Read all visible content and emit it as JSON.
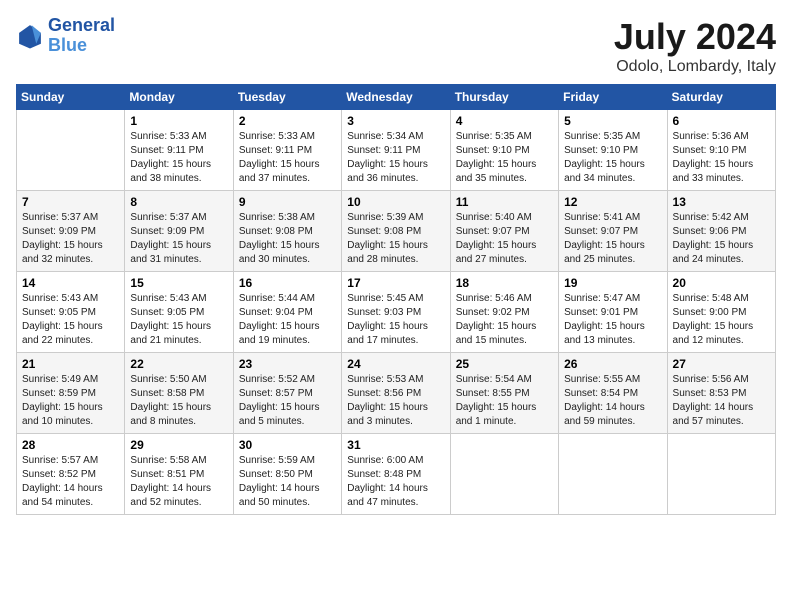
{
  "header": {
    "logo_general": "General",
    "logo_blue": "Blue",
    "title": "July 2024",
    "location": "Odolo, Lombardy, Italy"
  },
  "calendar": {
    "days_of_week": [
      "Sunday",
      "Monday",
      "Tuesday",
      "Wednesday",
      "Thursday",
      "Friday",
      "Saturday"
    ],
    "weeks": [
      [
        {
          "day": "",
          "info": ""
        },
        {
          "day": "1",
          "info": "Sunrise: 5:33 AM\nSunset: 9:11 PM\nDaylight: 15 hours\nand 38 minutes."
        },
        {
          "day": "2",
          "info": "Sunrise: 5:33 AM\nSunset: 9:11 PM\nDaylight: 15 hours\nand 37 minutes."
        },
        {
          "day": "3",
          "info": "Sunrise: 5:34 AM\nSunset: 9:11 PM\nDaylight: 15 hours\nand 36 minutes."
        },
        {
          "day": "4",
          "info": "Sunrise: 5:35 AM\nSunset: 9:10 PM\nDaylight: 15 hours\nand 35 minutes."
        },
        {
          "day": "5",
          "info": "Sunrise: 5:35 AM\nSunset: 9:10 PM\nDaylight: 15 hours\nand 34 minutes."
        },
        {
          "day": "6",
          "info": "Sunrise: 5:36 AM\nSunset: 9:10 PM\nDaylight: 15 hours\nand 33 minutes."
        }
      ],
      [
        {
          "day": "7",
          "info": "Sunrise: 5:37 AM\nSunset: 9:09 PM\nDaylight: 15 hours\nand 32 minutes."
        },
        {
          "day": "8",
          "info": "Sunrise: 5:37 AM\nSunset: 9:09 PM\nDaylight: 15 hours\nand 31 minutes."
        },
        {
          "day": "9",
          "info": "Sunrise: 5:38 AM\nSunset: 9:08 PM\nDaylight: 15 hours\nand 30 minutes."
        },
        {
          "day": "10",
          "info": "Sunrise: 5:39 AM\nSunset: 9:08 PM\nDaylight: 15 hours\nand 28 minutes."
        },
        {
          "day": "11",
          "info": "Sunrise: 5:40 AM\nSunset: 9:07 PM\nDaylight: 15 hours\nand 27 minutes."
        },
        {
          "day": "12",
          "info": "Sunrise: 5:41 AM\nSunset: 9:07 PM\nDaylight: 15 hours\nand 25 minutes."
        },
        {
          "day": "13",
          "info": "Sunrise: 5:42 AM\nSunset: 9:06 PM\nDaylight: 15 hours\nand 24 minutes."
        }
      ],
      [
        {
          "day": "14",
          "info": "Sunrise: 5:43 AM\nSunset: 9:05 PM\nDaylight: 15 hours\nand 22 minutes."
        },
        {
          "day": "15",
          "info": "Sunrise: 5:43 AM\nSunset: 9:05 PM\nDaylight: 15 hours\nand 21 minutes."
        },
        {
          "day": "16",
          "info": "Sunrise: 5:44 AM\nSunset: 9:04 PM\nDaylight: 15 hours\nand 19 minutes."
        },
        {
          "day": "17",
          "info": "Sunrise: 5:45 AM\nSunset: 9:03 PM\nDaylight: 15 hours\nand 17 minutes."
        },
        {
          "day": "18",
          "info": "Sunrise: 5:46 AM\nSunset: 9:02 PM\nDaylight: 15 hours\nand 15 minutes."
        },
        {
          "day": "19",
          "info": "Sunrise: 5:47 AM\nSunset: 9:01 PM\nDaylight: 15 hours\nand 13 minutes."
        },
        {
          "day": "20",
          "info": "Sunrise: 5:48 AM\nSunset: 9:00 PM\nDaylight: 15 hours\nand 12 minutes."
        }
      ],
      [
        {
          "day": "21",
          "info": "Sunrise: 5:49 AM\nSunset: 8:59 PM\nDaylight: 15 hours\nand 10 minutes."
        },
        {
          "day": "22",
          "info": "Sunrise: 5:50 AM\nSunset: 8:58 PM\nDaylight: 15 hours\nand 8 minutes."
        },
        {
          "day": "23",
          "info": "Sunrise: 5:52 AM\nSunset: 8:57 PM\nDaylight: 15 hours\nand 5 minutes."
        },
        {
          "day": "24",
          "info": "Sunrise: 5:53 AM\nSunset: 8:56 PM\nDaylight: 15 hours\nand 3 minutes."
        },
        {
          "day": "25",
          "info": "Sunrise: 5:54 AM\nSunset: 8:55 PM\nDaylight: 15 hours\nand 1 minute."
        },
        {
          "day": "26",
          "info": "Sunrise: 5:55 AM\nSunset: 8:54 PM\nDaylight: 14 hours\nand 59 minutes."
        },
        {
          "day": "27",
          "info": "Sunrise: 5:56 AM\nSunset: 8:53 PM\nDaylight: 14 hours\nand 57 minutes."
        }
      ],
      [
        {
          "day": "28",
          "info": "Sunrise: 5:57 AM\nSunset: 8:52 PM\nDaylight: 14 hours\nand 54 minutes."
        },
        {
          "day": "29",
          "info": "Sunrise: 5:58 AM\nSunset: 8:51 PM\nDaylight: 14 hours\nand 52 minutes."
        },
        {
          "day": "30",
          "info": "Sunrise: 5:59 AM\nSunset: 8:50 PM\nDaylight: 14 hours\nand 50 minutes."
        },
        {
          "day": "31",
          "info": "Sunrise: 6:00 AM\nSunset: 8:48 PM\nDaylight: 14 hours\nand 47 minutes."
        },
        {
          "day": "",
          "info": ""
        },
        {
          "day": "",
          "info": ""
        },
        {
          "day": "",
          "info": ""
        }
      ]
    ]
  }
}
